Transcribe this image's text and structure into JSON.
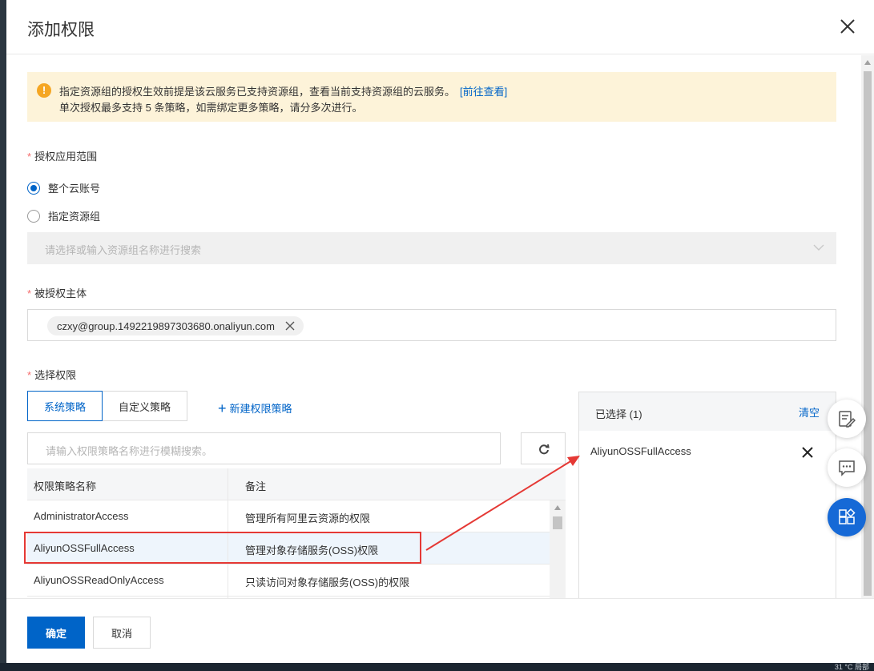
{
  "dialog": {
    "title": "添加权限"
  },
  "notice": {
    "line1": "指定资源组的授权生效前提是该云服务已支持资源组，查看当前支持资源组的云服务。",
    "link": "[前往查看]",
    "line2": "单次授权最多支持 5 条策略，如需绑定更多策略，请分多次进行。"
  },
  "scope": {
    "label": "授权应用范围",
    "required_mark": "*",
    "options": [
      {
        "label": "整个云账号",
        "checked": true
      },
      {
        "label": "指定资源组",
        "checked": false
      }
    ],
    "resource_group_placeholder": "请选择或输入资源组名称进行搜索"
  },
  "principal": {
    "label": "被授权主体",
    "required_mark": "*",
    "value": "czxy@group.1492219897303680.onaliyun.com"
  },
  "permissions": {
    "label": "选择权限",
    "required_mark": "*",
    "tabs": [
      {
        "label": "系统策略",
        "active": true
      },
      {
        "label": "自定义策略",
        "active": false
      }
    ],
    "new_policy": "新建权限策略",
    "new_policy_plus": "+",
    "search_placeholder": "请输入权限策略名称进行模糊搜索。",
    "table": {
      "headers": [
        "权限策略名称",
        "备注"
      ],
      "rows": [
        {
          "name": "AdministratorAccess",
          "note": "管理所有阿里云资源的权限"
        },
        {
          "name": "AliyunOSSFullAccess",
          "note": "管理对象存储服务(OSS)权限",
          "highlighted": true
        },
        {
          "name": "AliyunOSSReadOnlyAccess",
          "note": "只读访问对象存储服务(OSS)的权限"
        }
      ]
    }
  },
  "selected": {
    "title": "已选择",
    "count": "(1)",
    "clear": "清空",
    "items": [
      "AliyunOSSFullAccess"
    ]
  },
  "footer": {
    "confirm": "确定",
    "cancel": "取消"
  },
  "taskbar": {
    "text": "31 °C 局部"
  },
  "colors": {
    "accent": "#0064c8",
    "annotation_red": "#e53935",
    "notice_bg": "#fdf3d9",
    "warning": "#f5a623"
  }
}
